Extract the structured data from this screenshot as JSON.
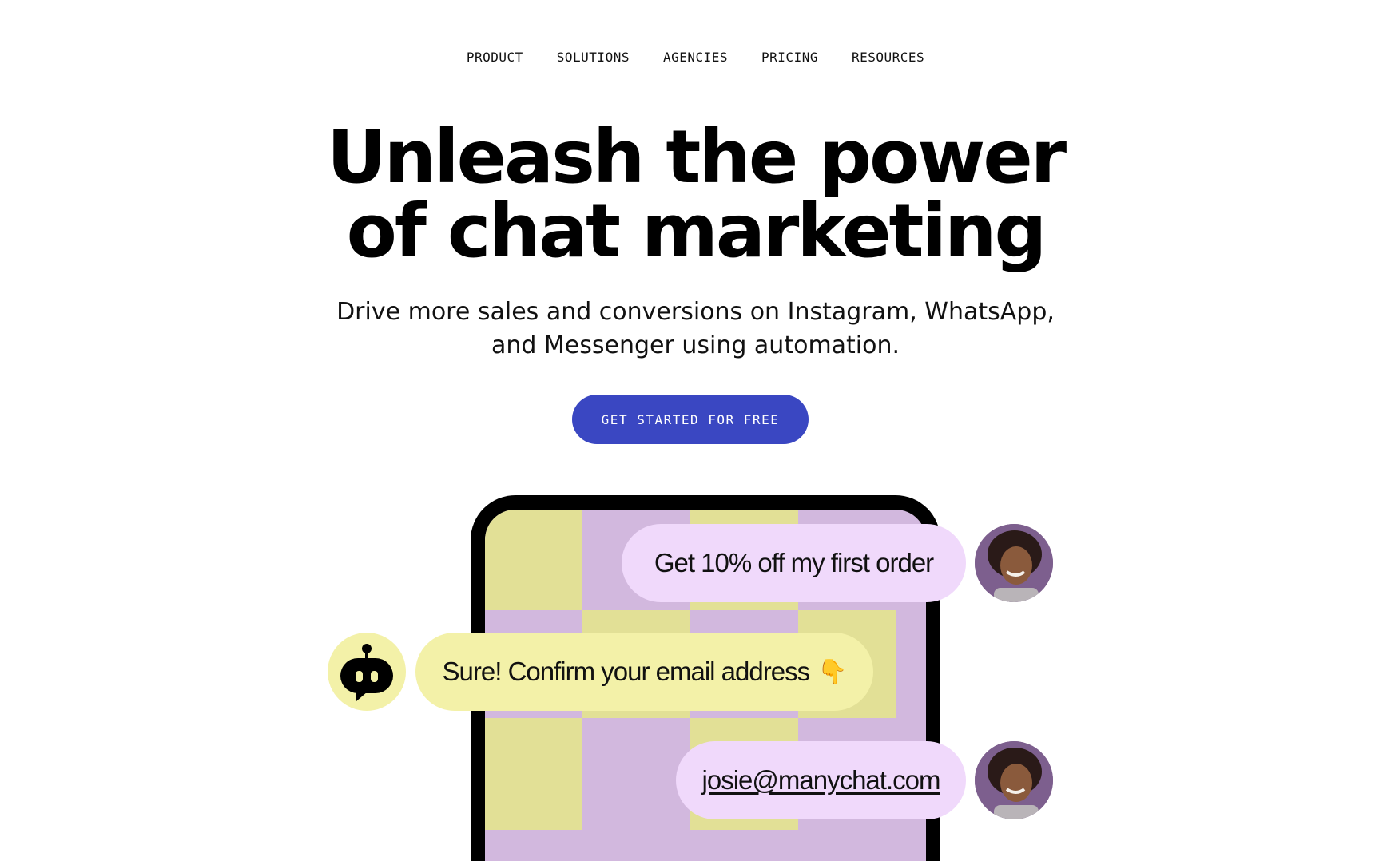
{
  "nav": {
    "items": [
      "PRODUCT",
      "SOLUTIONS",
      "AGENCIES",
      "PRICING",
      "RESOURCES"
    ]
  },
  "hero": {
    "headline_line1": "Unleash the power",
    "headline_line2": "of chat marketing",
    "subhead_line1": "Drive more sales and conversions on Instagram, WhatsApp,",
    "subhead_line2": "and Messenger using automation.",
    "cta_label": "GET STARTED FOR FREE"
  },
  "chat": {
    "user_message_1": "Get 10% off my first order",
    "bot_message": "Sure! Confirm your email address",
    "bot_emoji": "👇",
    "user_message_2": "josie@manychat.com"
  },
  "colors": {
    "cta": "#3a47c2",
    "user_bubble": "#f0d9fb",
    "bot_bubble": "#f3f1a8",
    "tile_yellow": "#e2e096",
    "tile_purple": "#d2b8de"
  }
}
